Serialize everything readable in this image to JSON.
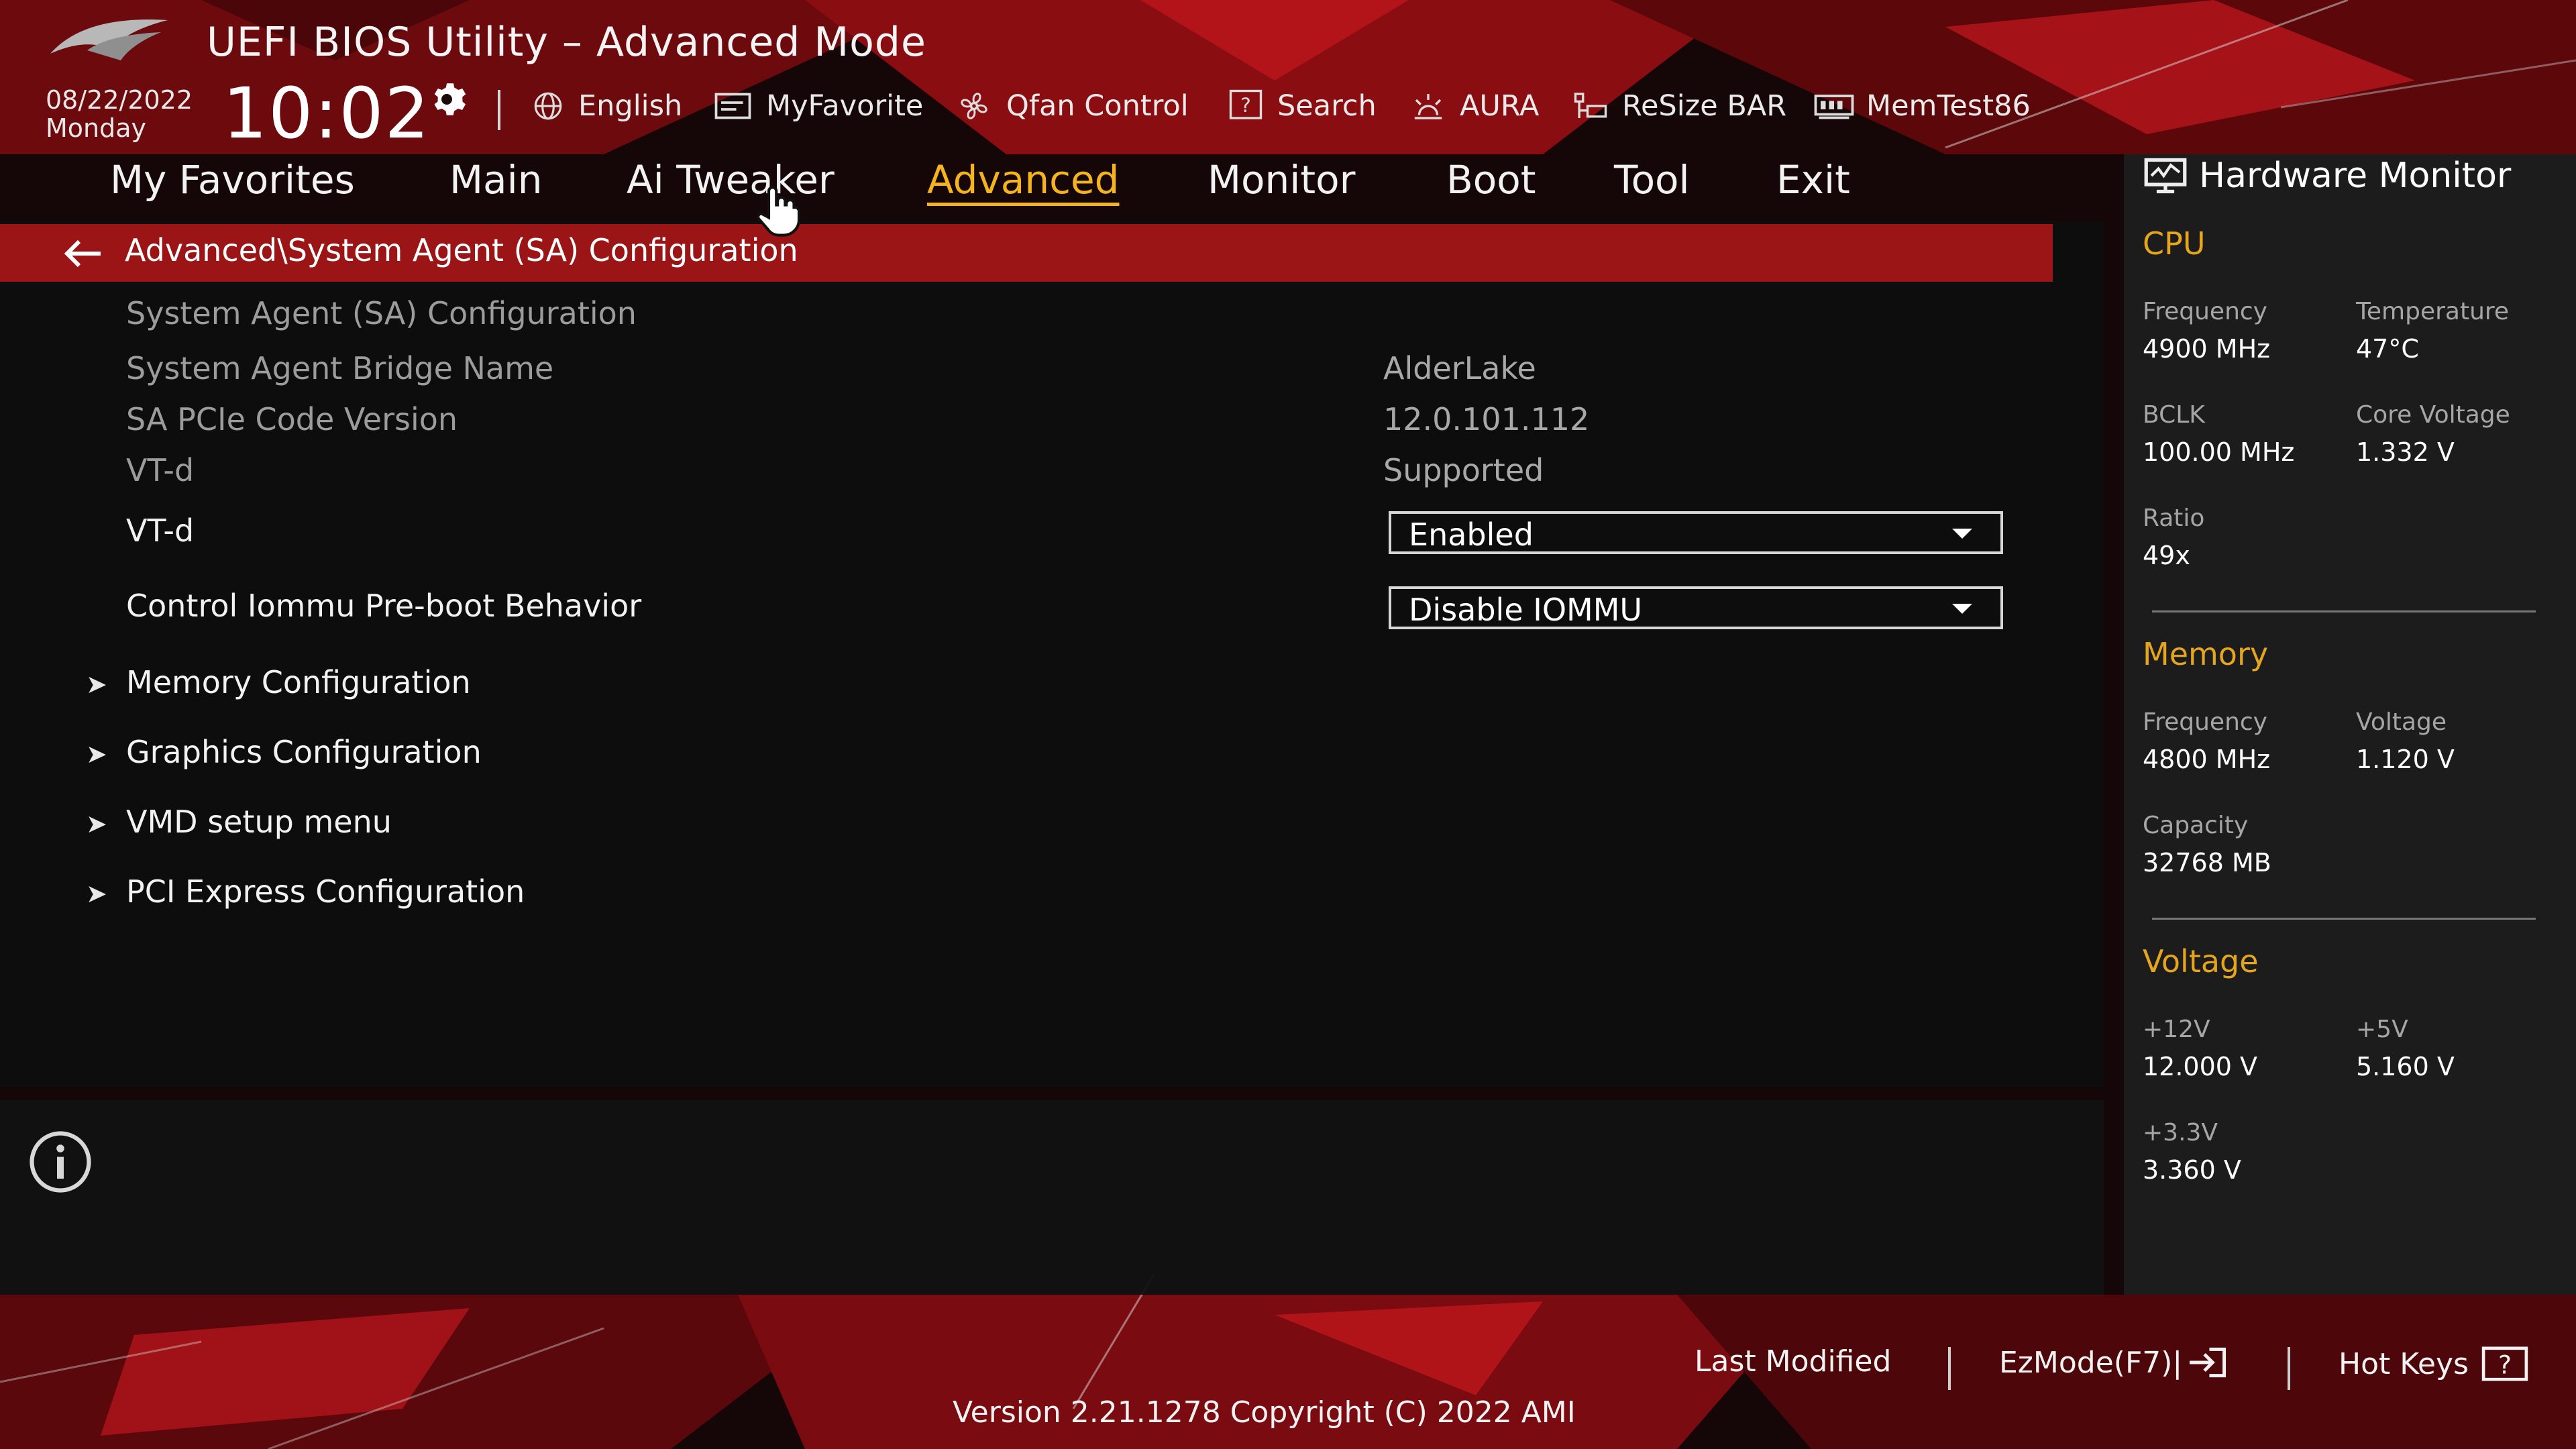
{
  "header": {
    "title": "UEFI BIOS Utility – Advanced Mode",
    "date": "08/22/2022",
    "day": "Monday",
    "time": "10:02",
    "toolbar": [
      {
        "label": "English",
        "icon": "globe-icon"
      },
      {
        "label": "MyFavorite",
        "icon": "favorite-icon"
      },
      {
        "label": "Qfan Control",
        "icon": "fan-icon"
      },
      {
        "label": "Search",
        "icon": "search-icon"
      },
      {
        "label": "AURA",
        "icon": "aura-icon"
      },
      {
        "label": "ReSize BAR",
        "icon": "resize-bar-icon"
      },
      {
        "label": "MemTest86",
        "icon": "memtest-icon"
      }
    ]
  },
  "tabs": [
    {
      "label": "My Favorites",
      "active": false
    },
    {
      "label": "Main",
      "active": false
    },
    {
      "label": "Ai Tweaker",
      "active": false
    },
    {
      "label": "Advanced",
      "active": true
    },
    {
      "label": "Monitor",
      "active": false
    },
    {
      "label": "Boot",
      "active": false
    },
    {
      "label": "Tool",
      "active": false
    },
    {
      "label": "Exit",
      "active": false
    }
  ],
  "breadcrumb": "Advanced\\System Agent (SA) Configuration",
  "content": {
    "section_heading": "System Agent (SA) Configuration",
    "info_rows": [
      {
        "label": "System Agent Bridge Name",
        "value": "AlderLake"
      },
      {
        "label": "SA PCIe Code Version",
        "value": "12.0.101.112"
      },
      {
        "label": "VT-d",
        "value": "Supported"
      }
    ],
    "settings": [
      {
        "label": "VT-d",
        "value": "Enabled"
      },
      {
        "label": "Control Iommu Pre-boot Behavior",
        "value": "Disable IOMMU"
      }
    ],
    "submenus": [
      "Memory Configuration",
      "Graphics Configuration",
      "VMD setup menu",
      "PCI Express Configuration"
    ]
  },
  "hardware_monitor": {
    "title": "Hardware Monitor",
    "cpu": {
      "heading": "CPU",
      "frequency_label": "Frequency",
      "frequency": "4900 MHz",
      "temperature_label": "Temperature",
      "temperature": "47°C",
      "bclk_label": "BCLK",
      "bclk": "100.00 MHz",
      "core_voltage_label": "Core Voltage",
      "core_voltage": "1.332 V",
      "ratio_label": "Ratio",
      "ratio": "49x"
    },
    "memory": {
      "heading": "Memory",
      "frequency_label": "Frequency",
      "frequency": "4800 MHz",
      "voltage_label": "Voltage",
      "voltage": "1.120 V",
      "capacity_label": "Capacity",
      "capacity": "32768 MB"
    },
    "voltage": {
      "heading": "Voltage",
      "v12_label": "+12V",
      "v12": "12.000 V",
      "v5_label": "+5V",
      "v5": "5.160 V",
      "v33_label": "+3.3V",
      "v33": "3.360 V"
    }
  },
  "footer": {
    "last_modified": "Last Modified",
    "ezmode": "EzMode(F7)|",
    "hot_keys": "Hot Keys",
    "version": "Version 2.21.1278 Copyright (C) 2022 AMI"
  },
  "colors": {
    "accent": "#f5b41e",
    "breadcrumb_bg": "#9b1416",
    "section_heading": "#e5a61e"
  }
}
